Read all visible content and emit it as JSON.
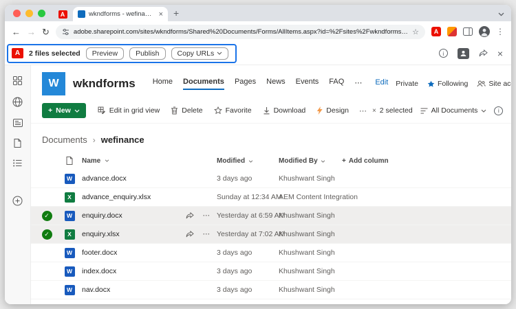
{
  "colors": {
    "selection_border_blue": "#1a73e8",
    "adobe_red": "#eb1000",
    "accent_blue": "#0f6cbd",
    "new_button_green": "#107c41",
    "word_blue": "#185abd",
    "excel_green": "#107c41",
    "check_green": "#107c10",
    "site_logo_blue": "#2488d8",
    "expand_teal": "#038387"
  },
  "browser": {
    "tab_title": "wkndforms - wefinance - All",
    "url": "adobe.sharepoint.com/sites/wkndforms/Shared%20Documents/Forms/AllItems.aspx?id=%2Fsites%2Fwkndforms…"
  },
  "selection_toolbar": {
    "label": "2 files selected",
    "buttons": [
      "Preview",
      "Publish",
      "Copy URLs"
    ]
  },
  "site": {
    "logo_letter": "W",
    "title": "wkndforms",
    "nav": [
      "Home",
      "Documents",
      "Pages",
      "News",
      "Events",
      "FAQ"
    ],
    "edit_label": "Edit",
    "privacy_label": "Private",
    "following_label": "Following",
    "site_access_label": "Site access"
  },
  "command_bar": {
    "new_label": "New",
    "items": [
      "Edit in grid view",
      "Delete",
      "Favorite",
      "Download",
      "Design"
    ],
    "selected_label": "2 selected",
    "view_label": "All Documents"
  },
  "breadcrumb": {
    "root": "Documents",
    "current": "wefinance"
  },
  "table": {
    "columns": [
      "Name",
      "Modified",
      "Modified By"
    ],
    "add_column_label": "Add column",
    "rows": [
      {
        "name": "advance.docx",
        "type": "word",
        "modified": "3 days ago",
        "modified_by": "Khushwant Singh",
        "selected": false
      },
      {
        "name": "advance_enquiry.xlsx",
        "type": "excel",
        "modified": "Sunday at 12:34 AM",
        "modified_by": "AEM Content Integration",
        "selected": false
      },
      {
        "name": "enquiry.docx",
        "type": "word",
        "modified": "Yesterday at 6:59 AM",
        "modified_by": "Khushwant Singh",
        "selected": true
      },
      {
        "name": "enquiry.xlsx",
        "type": "excel",
        "modified": "Yesterday at 7:02 AM",
        "modified_by": "Khushwant Singh",
        "selected": true
      },
      {
        "name": "footer.docx",
        "type": "word",
        "modified": "3 days ago",
        "modified_by": "Khushwant Singh",
        "selected": false
      },
      {
        "name": "index.docx",
        "type": "word",
        "modified": "3 days ago",
        "modified_by": "Khushwant Singh",
        "selected": false
      },
      {
        "name": "nav.docx",
        "type": "word",
        "modified": "3 days ago",
        "modified_by": "Khushwant Singh",
        "selected": false
      }
    ]
  },
  "icons": {
    "back": "←",
    "forward": "→",
    "reload": "↻",
    "bookmark": "☆",
    "menu": "⋮",
    "overflow": "⋯",
    "close": "×",
    "plus": "+",
    "check": "✓",
    "info": "i",
    "expand": "↗",
    "breadcrumb_sep": "›",
    "adobe_letter": "A"
  }
}
